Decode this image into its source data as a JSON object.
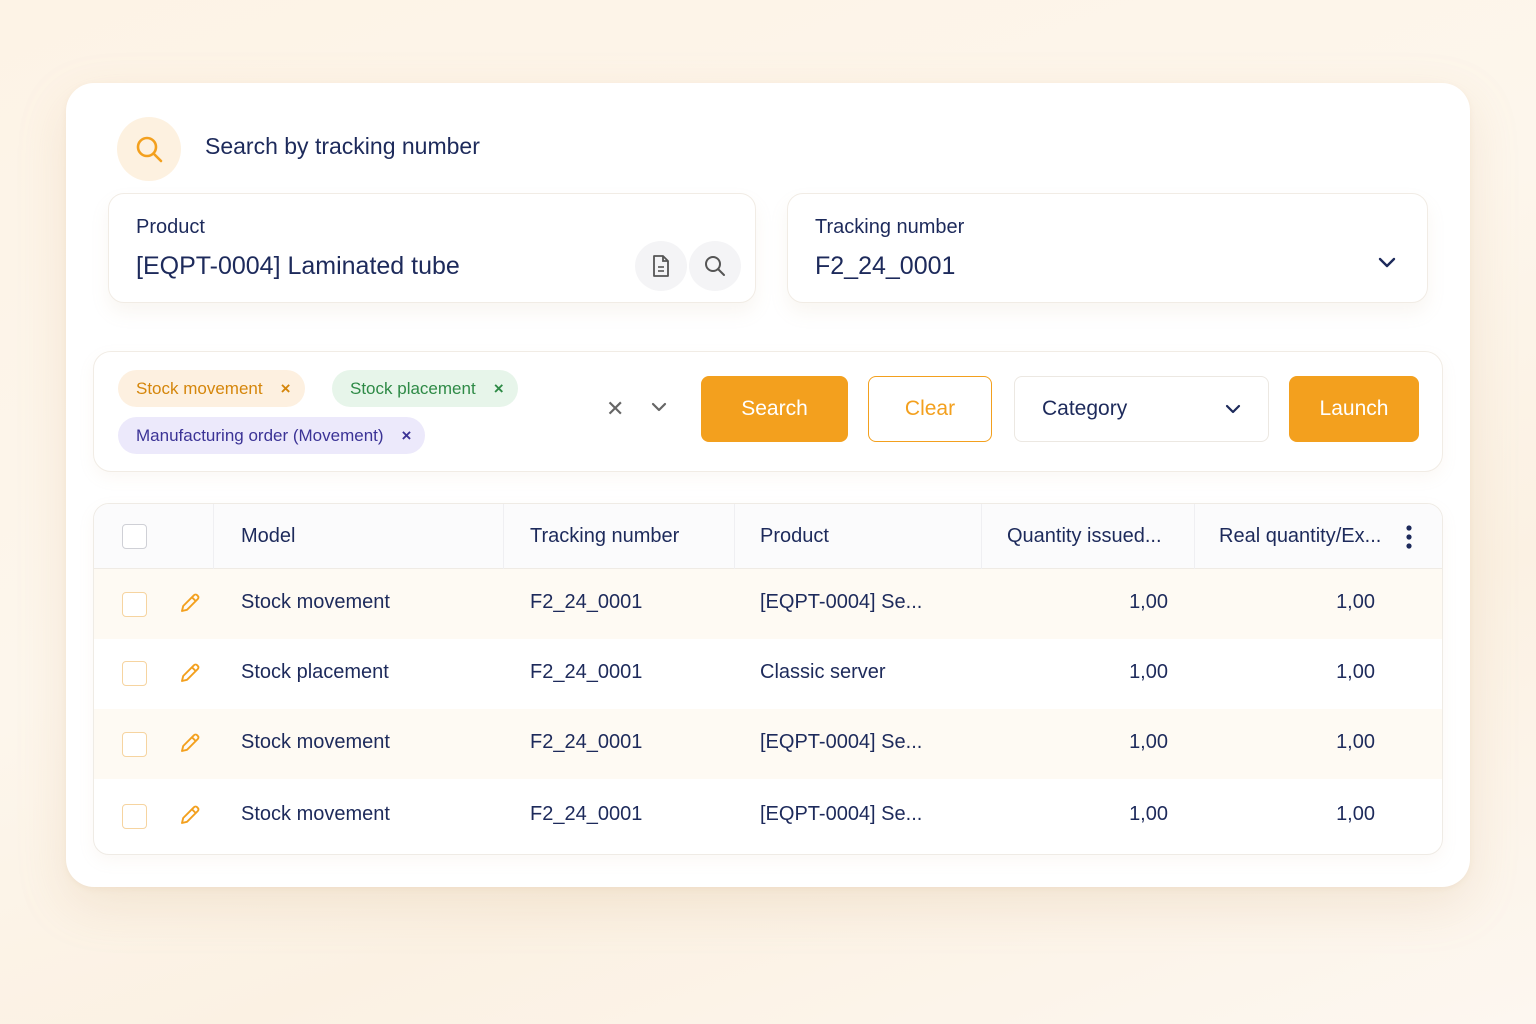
{
  "header": {
    "title": "Search by tracking number",
    "icon": "search-icon"
  },
  "product_field": {
    "label": "Product",
    "value": "[EQPT-0004] Laminated tube"
  },
  "tracking_field": {
    "label": "Tracking number",
    "value": "F2_24_0001"
  },
  "filters": {
    "chips": [
      {
        "label": "Stock movement",
        "color": "#d5860b"
      },
      {
        "label": "Stock placement",
        "color": "#2e8a46"
      },
      {
        "label": "Manufacturing order (Movement)",
        "color": "#3b3396"
      }
    ],
    "chip_remove": "×",
    "clear_all": "✕",
    "search_label": "Search",
    "clear_label": "Clear",
    "category_label": "Category",
    "launch_label": "Launch"
  },
  "table": {
    "columns": [
      "Model",
      "Tracking number",
      "Product",
      "Quantity issued...",
      "Real quantity/Ex..."
    ],
    "rows": [
      {
        "model": "Stock movement",
        "tracking": "F2_24_0001",
        "product": "[EQPT-0004] Se...",
        "qty_issued": "1,00",
        "real_qty": "1,00"
      },
      {
        "model": "Stock placement",
        "tracking": "F2_24_0001",
        "product": "Classic server",
        "qty_issued": "1,00",
        "real_qty": "1,00"
      },
      {
        "model": "Stock movement",
        "tracking": "F2_24_0001",
        "product": "[EQPT-0004] Se...",
        "qty_issued": "1,00",
        "real_qty": "1,00"
      },
      {
        "model": "Stock movement",
        "tracking": "F2_24_0001",
        "product": "[EQPT-0004] Se...",
        "qty_issued": "1,00",
        "real_qty": "1,00"
      }
    ]
  },
  "colors": {
    "accent": "#f3a01e",
    "text": "#1d2a5b"
  }
}
